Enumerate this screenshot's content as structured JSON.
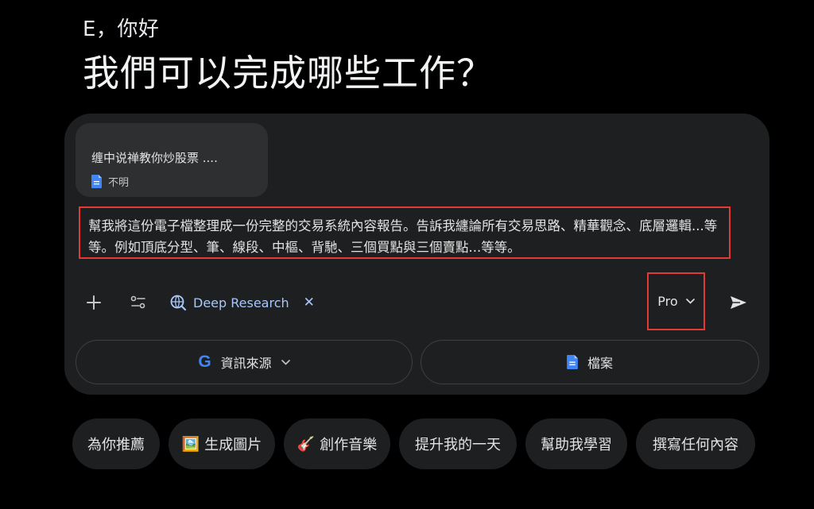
{
  "greeting": "E，你好",
  "headline": "我們可以完成哪些工作？",
  "attachment": {
    "title": "缠中说禅教你炒股票 ....",
    "meta": "不明",
    "icon": "document-icon"
  },
  "prompt": {
    "text": "幫我將這份電子檔整理成一份完整的交易系統內容報告。告訴我纏論所有交易思路、精華觀念、底層邏輯...等等。例如頂底分型、筆、線段、中樞、背馳、三個買點與三個賣點...等等。"
  },
  "toolbar": {
    "add_icon": "plus-icon",
    "tools_icon": "tools-icon",
    "deep_research_label": "Deep Research",
    "deep_research_close": "✕",
    "model_label": "Pro",
    "send_icon": "send-icon"
  },
  "sources": {
    "source_label": "資訊來源",
    "files_label": "檔案"
  },
  "suggestions": [
    {
      "label": "為你推薦",
      "emoji": ""
    },
    {
      "label": "生成圖片",
      "emoji": "🖼️"
    },
    {
      "label": "創作音樂",
      "emoji": "🎸"
    },
    {
      "label": "提升我的一天",
      "emoji": ""
    },
    {
      "label": "幫助我學習",
      "emoji": ""
    },
    {
      "label": "撰寫任何內容",
      "emoji": ""
    }
  ],
  "colors": {
    "background": "#000000",
    "panel": "#1e1f20",
    "accent_blue": "#a8c7fa",
    "highlight_red": "#e53935",
    "doc_blue": "#4285f4"
  }
}
